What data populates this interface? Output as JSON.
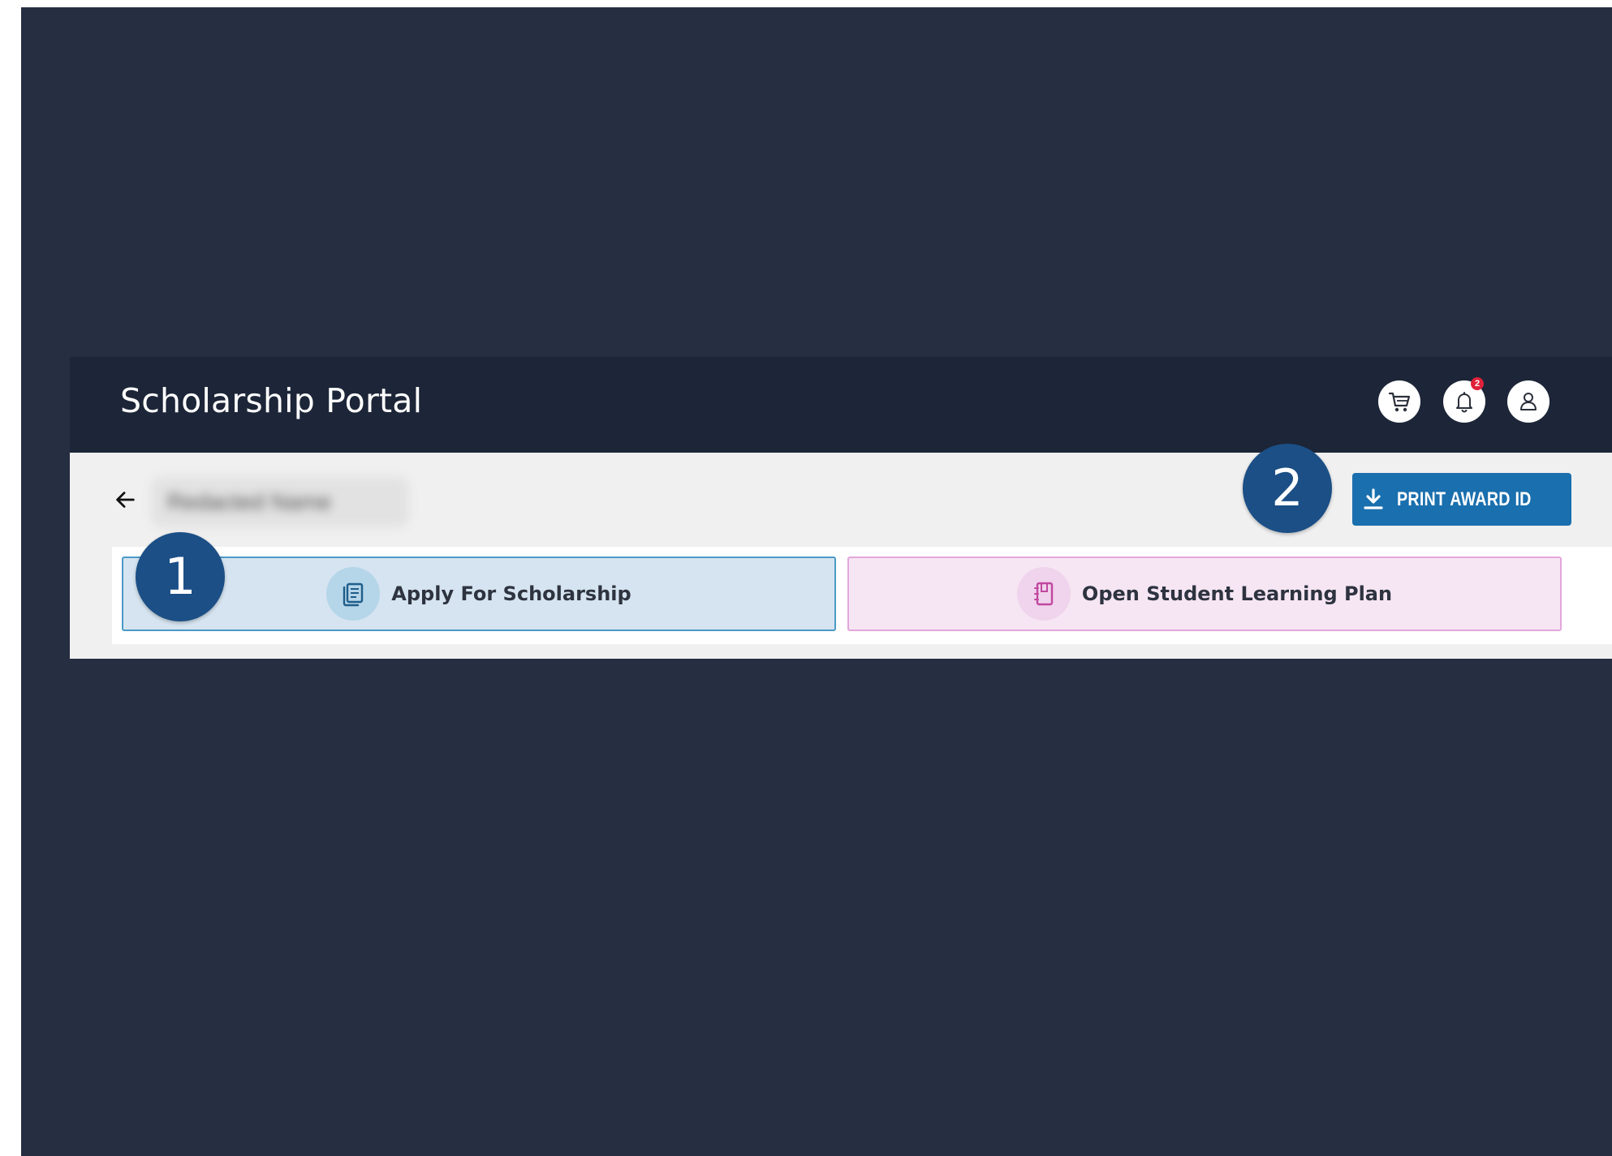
{
  "header": {
    "title": "Scholarship Portal",
    "icons": [
      {
        "name": "cart-icon"
      },
      {
        "name": "bell-icon",
        "badge": "2"
      },
      {
        "name": "user-icon"
      }
    ]
  },
  "page": {
    "back_icon": "arrow-left-icon",
    "record_name_redacted": "Redacted Name",
    "print_button": {
      "label": "PRINT AWARD ID",
      "icon": "download-icon"
    }
  },
  "actions": [
    {
      "label": "Apply For Scholarship",
      "icon": "document-stack-icon",
      "accent": "#4a9ac7",
      "background": "#d5e4f0"
    },
    {
      "label": "Open Student Learning Plan",
      "icon": "notebook-icon",
      "accent": "#e3a6db",
      "background": "#f6e6f3"
    }
  ],
  "annotations": {
    "marker_1": "1",
    "marker_2": "2"
  },
  "colors": {
    "backdrop": "#262e42",
    "header": "#1d2638",
    "primary_button": "#1a6fae",
    "marker": "#1b4f86",
    "badge": "#e0213a"
  }
}
